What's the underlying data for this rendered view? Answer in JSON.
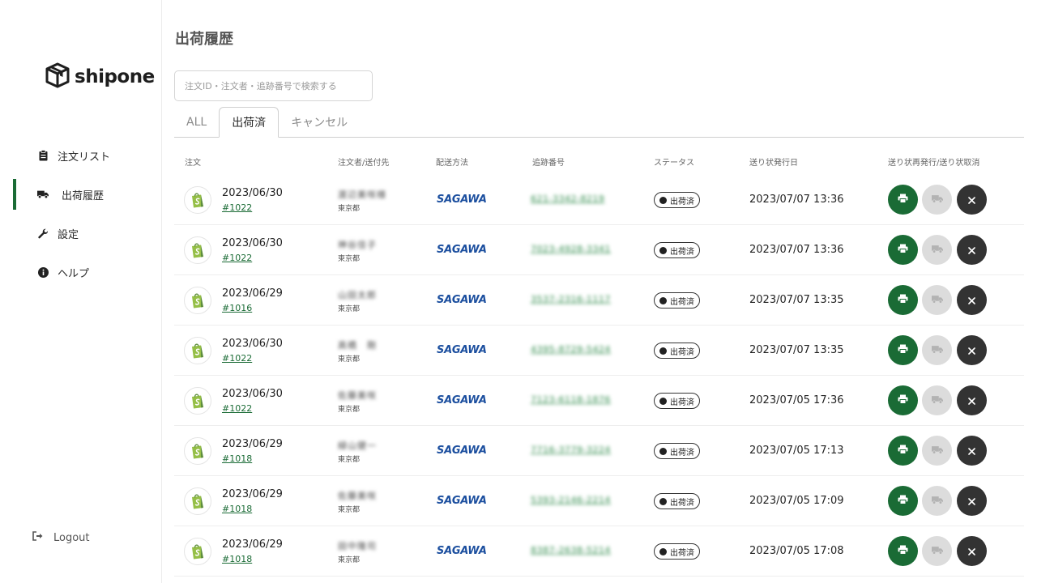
{
  "app": {
    "logo_text": "shipone"
  },
  "sidebar": {
    "items": [
      {
        "label": "注文リスト",
        "icon": "clipboard-icon",
        "active": false
      },
      {
        "label": "出荷履歴",
        "icon": "truck-icon",
        "active": true
      },
      {
        "label": "設定",
        "icon": "wrench-icon",
        "active": false
      },
      {
        "label": "ヘルプ",
        "icon": "info-icon",
        "active": false
      }
    ],
    "logout_label": "Logout"
  },
  "page": {
    "title": "出荷履歴"
  },
  "search": {
    "placeholder": "注文ID・注文者・追跡番号で検索する",
    "value": ""
  },
  "tabs": [
    {
      "label": "ALL",
      "active": false
    },
    {
      "label": "出荷済",
      "active": true
    },
    {
      "label": "キャンセル",
      "active": false
    }
  ],
  "table": {
    "columns": [
      "注文",
      "注文者/送付先",
      "配送方法",
      "追跡番号",
      "ステータス",
      "送り状発行日",
      "送り状再発行/送り状取消"
    ],
    "rows": [
      {
        "order_date": "2023/06/30",
        "order_id": "#1022",
        "customer": "渡辺美咲様",
        "city": "東京都",
        "carrier": "SAGAWA",
        "tracking": "621-3342-8219",
        "status": "出荷済",
        "issued": "2023/07/07 13:36"
      },
      {
        "order_date": "2023/06/30",
        "order_id": "#1022",
        "customer": "神谷佳子",
        "city": "東京都",
        "carrier": "SAGAWA",
        "tracking": "7023-4928-3341",
        "status": "出荷済",
        "issued": "2023/07/07 13:36"
      },
      {
        "order_date": "2023/06/29",
        "order_id": "#1016",
        "customer": "山田太郎",
        "city": "東京都",
        "carrier": "SAGAWA",
        "tracking": "3537-2316-1117",
        "status": "出荷済",
        "issued": "2023/07/07 13:35"
      },
      {
        "order_date": "2023/06/30",
        "order_id": "#1022",
        "customer": "高橋　剛",
        "city": "東京都",
        "carrier": "SAGAWA",
        "tracking": "4395-8729-5424",
        "status": "出荷済",
        "issued": "2023/07/07 13:35"
      },
      {
        "order_date": "2023/06/30",
        "order_id": "#1022",
        "customer": "佐藤美咲",
        "city": "東京都",
        "carrier": "SAGAWA",
        "tracking": "7123-6118-1876",
        "status": "出荷済",
        "issued": "2023/07/05 17:36"
      },
      {
        "order_date": "2023/06/29",
        "order_id": "#1018",
        "customer": "緑山健一",
        "city": "東京都",
        "carrier": "SAGAWA",
        "tracking": "7716-3779-3224",
        "status": "出荷済",
        "issued": "2023/07/05 17:13"
      },
      {
        "order_date": "2023/06/29",
        "order_id": "#1018",
        "customer": "佐藤美咲",
        "city": "東京都",
        "carrier": "SAGAWA",
        "tracking": "5393-2146-2214",
        "status": "出荷済",
        "issued": "2023/07/05 17:09"
      },
      {
        "order_date": "2023/06/29",
        "order_id": "#1018",
        "customer": "田中隆司",
        "city": "東京都",
        "carrier": "SAGAWA",
        "tracking": "8387-2638-5214",
        "status": "出荷済",
        "issued": "2023/07/05 17:08"
      }
    ],
    "action_icons": [
      "printer-icon",
      "truck-icon",
      "close-icon"
    ]
  },
  "colors": {
    "brand_green": "#1a6b35",
    "carrier_blue": "#1c4f9f",
    "disabled_gray": "#dcdcdc",
    "dark": "#333333"
  }
}
